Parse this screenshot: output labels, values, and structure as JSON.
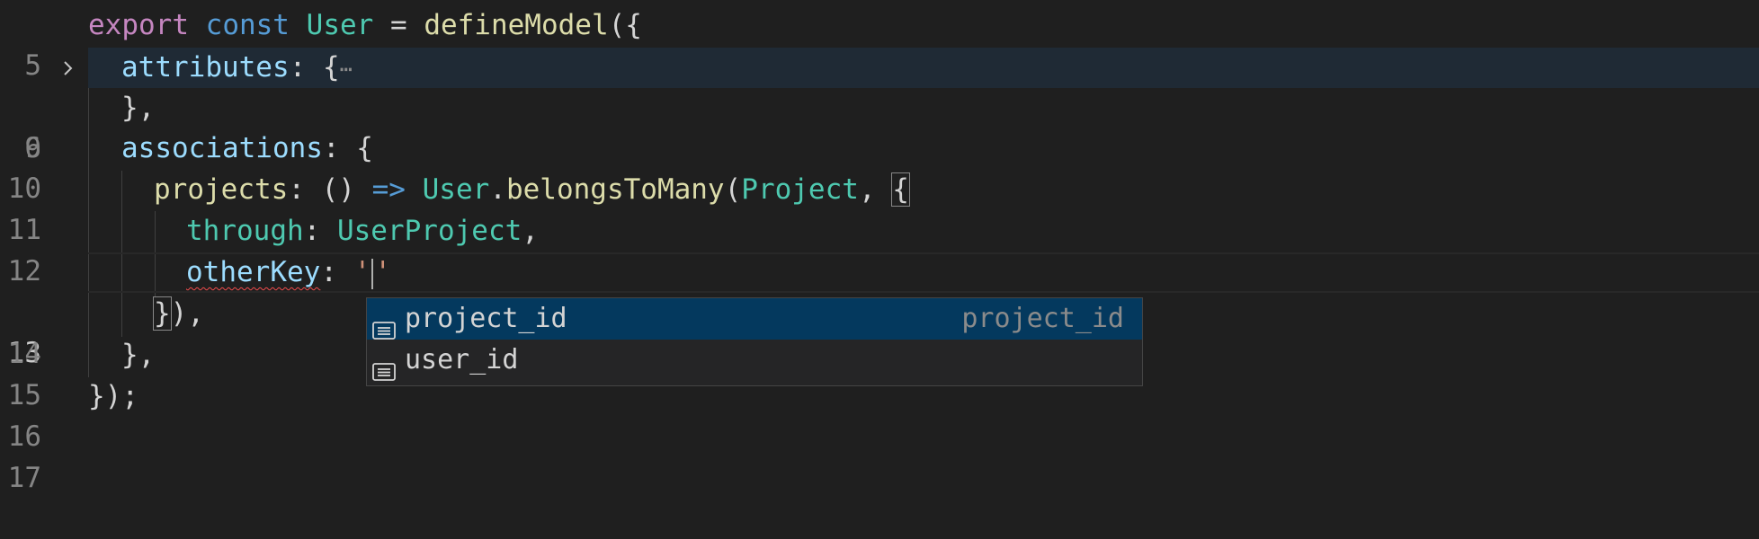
{
  "editor": {
    "lines": [
      {
        "num": "5"
      },
      {
        "num": "6"
      },
      {
        "num": "9"
      },
      {
        "num": "10"
      },
      {
        "num": "11"
      },
      {
        "num": "12"
      },
      {
        "num": "13"
      },
      {
        "num": "14"
      },
      {
        "num": "15"
      },
      {
        "num": "16"
      },
      {
        "num": "17"
      }
    ],
    "tokens": {
      "l5_export": "export",
      "l5_const": "const",
      "l5_user": "User",
      "l5_eq": " = ",
      "l5_define": "defineModel",
      "l5_open": "({",
      "l6_attributes": "attributes",
      "l6_colon": ": {",
      "l6_ellipsis": "⋯",
      "l9_close": "},",
      "l10_associations": "associations",
      "l10_colon": ": {",
      "l11_projects": "projects",
      "l11_colon": ": () ",
      "l11_arrow": "=>",
      "l11_user": "User",
      "l11_dot": ".",
      "l11_belongs": "belongsToMany",
      "l11_paren": "(",
      "l11_project": "Project",
      "l11_comma": ", ",
      "l11_brace": "{",
      "l12_through": "through",
      "l12_colon": ": ",
      "l12_userproject": "UserProject",
      "l12_comma": ",",
      "l13_otherkey": "otherKey",
      "l13_colon": ": ",
      "l13_quote1": "'",
      "l13_quote2": "'",
      "l14_brace": "}",
      "l14_rest": "),",
      "l15_close": "},",
      "l16_close": "});"
    }
  },
  "suggest": {
    "items": [
      {
        "label": "project_id",
        "detail": "project_id"
      },
      {
        "label": "user_id",
        "detail": ""
      }
    ]
  },
  "icons": {
    "fold": "chevron-right-icon",
    "suggest_item": "text-field-icon"
  },
  "colors": {
    "background": "#1f1f1f",
    "selected_suggestion": "#04395e",
    "keyword": "#569cd6",
    "control_keyword": "#c586c0",
    "type": "#4ec9b0",
    "function": "#dcdcaa",
    "property": "#9cdcfe",
    "string": "#ce9178",
    "error_squiggle": "#f14c4c"
  }
}
